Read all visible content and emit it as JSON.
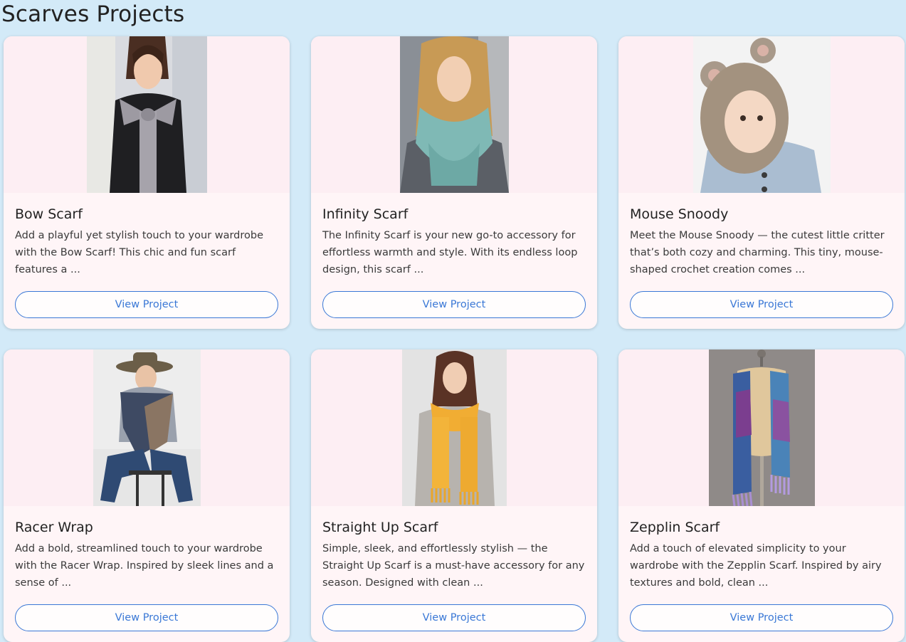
{
  "page": {
    "title": "Scarves Projects"
  },
  "cards": [
    {
      "title": "Bow Scarf",
      "desc": "Add a playful yet stylish touch to your wardrobe with the Bow Scarf! This chic and fun scarf features a ...",
      "button": "View Project"
    },
    {
      "title": "Infinity Scarf",
      "desc": "The Infinity Scarf is your new go-to accessory for effortless warmth and style. With its endless loop design, this scarf ...",
      "button": "View Project"
    },
    {
      "title": "Mouse Snoody",
      "desc": "Meet the Mouse Snoody — the cutest little critter that’s both cozy and charming. This tiny, mouse-shaped crochet creation comes ...",
      "button": "View Project"
    },
    {
      "title": "Racer Wrap",
      "desc": "Add a bold, streamlined touch to your wardrobe with the Racer Wrap. Inspired by sleek lines and a sense of ...",
      "button": "View Project"
    },
    {
      "title": "Straight Up Scarf",
      "desc": "Simple, sleek, and effortlessly stylish — the Straight Up Scarf is a must-have accessory for any season. Designed with clean ...",
      "button": "View Project"
    },
    {
      "title": "Zepplin Scarf",
      "desc": "Add a touch of elevated simplicity to your wardrobe with the Zepplin Scarf. Inspired by airy textures and bold, clean ...",
      "button": "View Project"
    }
  ]
}
